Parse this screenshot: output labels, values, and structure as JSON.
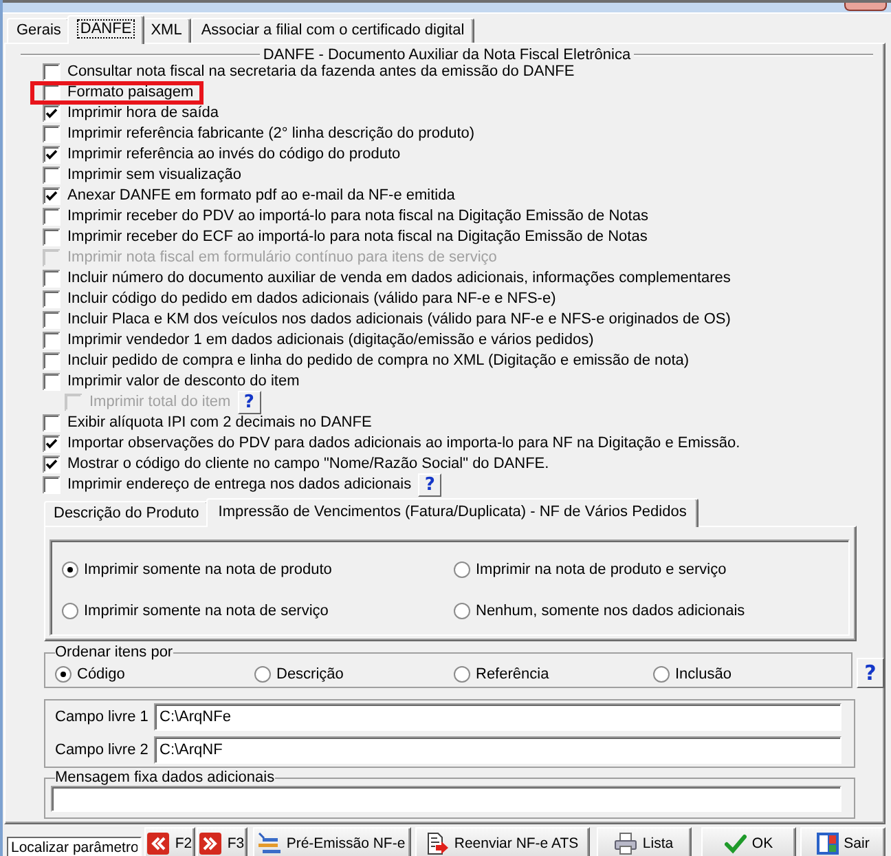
{
  "tabs": [
    {
      "label": "Gerais",
      "selected": false
    },
    {
      "label": "DANFE",
      "selected": true
    },
    {
      "label": "XML",
      "selected": false
    },
    {
      "label": "Associar a filial com o certificado digital",
      "selected": false
    }
  ],
  "danfe_group": {
    "title": "DANFE - Documento Auxiliar da Nota Fiscal Eletrônica",
    "options": [
      {
        "label": "Consultar nota fiscal na secretaria da fazenda antes da emissão do DANFE",
        "checked": false,
        "disabled": false,
        "highlighted": false
      },
      {
        "label": "Formato paisagem",
        "checked": false,
        "disabled": false,
        "highlighted": true
      },
      {
        "label": "Imprimir hora de saída",
        "checked": true,
        "disabled": false,
        "highlighted": false
      },
      {
        "label": "Imprimir referência fabricante (2° linha descrição do produto)",
        "checked": false,
        "disabled": false,
        "highlighted": false
      },
      {
        "label": "Imprimir referência ao invés do código do produto",
        "checked": true,
        "disabled": false,
        "highlighted": false
      },
      {
        "label": "Imprimir sem visualização",
        "checked": false,
        "disabled": false,
        "highlighted": false
      },
      {
        "label": "Anexar DANFE em formato pdf ao e-mail da NF-e emitida",
        "checked": true,
        "disabled": false,
        "highlighted": false
      },
      {
        "label": "Imprimir receber do PDV ao importá-lo para nota fiscal na Digitação Emissão de Notas",
        "checked": false,
        "disabled": false,
        "highlighted": false
      },
      {
        "label": "Imprimir receber do ECF ao importá-lo para nota fiscal na Digitação Emissão de Notas",
        "checked": false,
        "disabled": false,
        "highlighted": false
      },
      {
        "label": "Imprimir nota fiscal em formulário contínuo para itens de serviço",
        "checked": false,
        "disabled": true,
        "highlighted": false
      },
      {
        "label": "Incluir número do documento auxiliar de venda em dados adicionais, informações complementares",
        "checked": false,
        "disabled": false,
        "highlighted": false
      },
      {
        "label": "Incluir código do pedido em dados adicionais (válido para NF-e e NFS-e)",
        "checked": false,
        "disabled": false,
        "highlighted": false
      },
      {
        "label": "Incluir Placa e KM dos veículos nos dados adicionais (válido para NF-e e NFS-e originados de OS)",
        "checked": false,
        "disabled": false,
        "highlighted": false
      },
      {
        "label": "Imprimir vendedor 1 em dados adicionais (digitação/emissão e vários pedidos)",
        "checked": false,
        "disabled": false,
        "highlighted": false
      },
      {
        "label": "Incluir pedido de compra e linha do pedido de compra no XML (Digitação e emissão de nota)",
        "checked": false,
        "disabled": false,
        "highlighted": false
      },
      {
        "label": "Imprimir valor de desconto do item",
        "checked": false,
        "disabled": false,
        "highlighted": false,
        "children": [
          {
            "label": "Imprimir total do item",
            "checked": false,
            "disabled": true,
            "highlighted": false,
            "help_button": "?"
          }
        ]
      },
      {
        "label": "Exibir alíquota IPI com 2 decimais no DANFE",
        "checked": false,
        "disabled": false,
        "highlighted": false
      },
      {
        "label": "Importar observações do PDV para dados adicionais ao importa-lo para NF na Digitação e Emissão.",
        "checked": true,
        "disabled": false,
        "highlighted": false
      },
      {
        "label": "Mostrar o código do cliente no campo \"Nome/Razão Social\" do DANFE.",
        "checked": true,
        "disabled": false,
        "highlighted": false
      },
      {
        "label": "Imprimir endereço de entrega nos dados adicionais",
        "checked": false,
        "disabled": false,
        "highlighted": false,
        "help_button": "?"
      }
    ]
  },
  "subtabs": [
    {
      "label": "Descrição do Produto",
      "selected": false
    },
    {
      "label": "Impressão de Vencimentos (Fatura/Duplicata) - NF de Vários Pedidos",
      "selected": true
    }
  ],
  "vencimentos_options": [
    {
      "label": "Imprimir somente na nota de produto",
      "selected": true
    },
    {
      "label": "Imprimir na nota de produto e serviço",
      "selected": false
    },
    {
      "label": "Imprimir somente na nota de serviço",
      "selected": false
    },
    {
      "label": "Nenhum, somente nos dados adicionais",
      "selected": false
    }
  ],
  "sort_group": {
    "title": "Ordenar itens por",
    "options": [
      {
        "label": "Código",
        "selected": true
      },
      {
        "label": "Descrição",
        "selected": false
      },
      {
        "label": "Referência",
        "selected": false
      },
      {
        "label": "Inclusão",
        "selected": false
      }
    ],
    "help_button": "?"
  },
  "free_fields": [
    {
      "label": "Campo livre 1",
      "value": "C:\\ArqNFe"
    },
    {
      "label": "Campo livre 2",
      "value": "C:\\ArqNF"
    }
  ],
  "message_group": {
    "title": "Mensagem fixa dados adicionais"
  },
  "toolbar": {
    "search": {
      "placeholder": "Localizar parâmetro"
    },
    "buttons": [
      {
        "label": "F2",
        "kind": "prev"
      },
      {
        "label": "F3",
        "kind": "next"
      },
      {
        "label": "Pré-Emissão NF-e",
        "kind": "pre_emission"
      },
      {
        "label": "Reenviar NF-e ATS",
        "kind": "resend"
      },
      {
        "label": "Lista",
        "kind": "print"
      },
      {
        "label": "OK",
        "kind": "ok"
      },
      {
        "label": "Sair",
        "kind": "exit"
      }
    ]
  }
}
